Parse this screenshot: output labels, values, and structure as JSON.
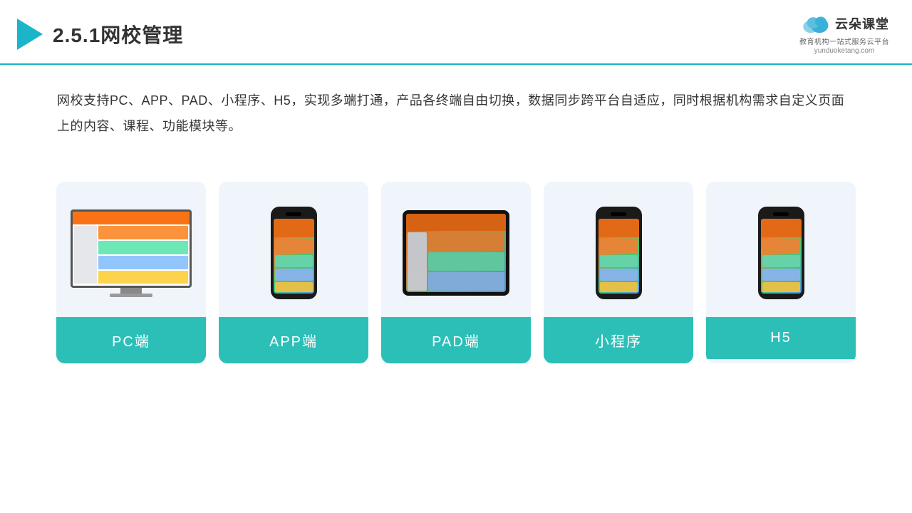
{
  "header": {
    "title": "2.5.1网校管理",
    "logo": {
      "brand": "云朵课堂",
      "url": "yunduoketang.com",
      "tagline": "教育机构一站式服务云平台"
    }
  },
  "description": "网校支持PC、APP、PAD、小程序、H5，实现多端打通，产品各终端自由切换，数据同步跨平台自适应，同时根据机构需求自定义页面上的内容、课程、功能模块等。",
  "cards": [
    {
      "id": "pc",
      "label": "PC端",
      "type": "pc"
    },
    {
      "id": "app",
      "label": "APP端",
      "type": "phone"
    },
    {
      "id": "pad",
      "label": "PAD端",
      "type": "pad"
    },
    {
      "id": "mini",
      "label": "小程序",
      "type": "phone2"
    },
    {
      "id": "h5",
      "label": "H5",
      "type": "phone3"
    }
  ],
  "accent_color": "#2bbfb8",
  "border_color": "#1ab5c8"
}
